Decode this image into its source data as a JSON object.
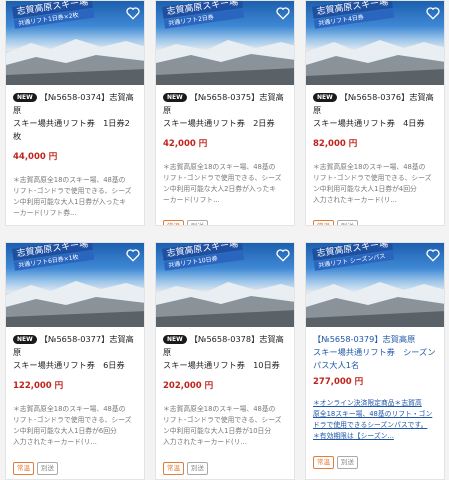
{
  "products": [
    {
      "title": "【№5658-0374】志賀高原スキー場共通リフト券　1日券2枚",
      "title_line1": "【№5658-0374】志賀高原",
      "title_line2": "スキー場共通リフト券　1日券2枚",
      "badge": "NEW",
      "price": "44,000 円",
      "description": "＊志賀高原全18のスキー場、48基のリフト･ゴンドラで使用できる、シーズン中利用可能な大人1日券が入ったキーカード(リフト券...",
      "desc_lines": [
        "＊志賀高原全18のスキー場、48基の",
        "リフト･ゴンドラで使用できる、シーズ",
        "ン中利用可能な大人1日券が入ったキ",
        "ーカード(リフト券..."
      ],
      "banner_main": "志賀高原スキー場",
      "banner_sub": "共通リフト1日券×2枚",
      "tags": [
        "常温",
        "別送"
      ]
    },
    {
      "title": "【№5658-0375】志賀高原スキー場共通リフト券　2日券",
      "title_line1": "【№5658-0375】志賀高原",
      "title_line2": "スキー場共通リフト券　2日券",
      "badge": "NEW",
      "price": "42,000 円",
      "description": "＊志賀高原全18のスキー場、48基のリフト･ゴンドラで使用できる、シーズン中利用可能な大人2日券が入ったキーカード(リフト...",
      "desc_lines": [
        "＊志賀高原全18のスキー場、48基の",
        "リフト･ゴンドラで使用できる、シーズ",
        "ン中利用可能な大人2日券が入ったキ",
        "ーカード(リフト..."
      ],
      "banner_main": "志賀高原スキー場",
      "banner_sub": "共通リフト2日券",
      "tags": [
        "常温",
        "別送"
      ]
    },
    {
      "title": "【№5658-0376】志賀高原スキー場共通リフト券　4日券",
      "title_line1": "【№5658-0376】志賀高原",
      "title_line2": "スキー場共通リフト券　4日券",
      "badge": "NEW",
      "price": "82,000 円",
      "description": "＊志賀高原全18のスキー場、48基のリフト･ゴンドラで使用できる、シーズン中利用可能な大人1日券が4回分入力されたキーカード(リ...",
      "desc_lines": [
        "＊志賀高原全18のスキー場、48基の",
        "リフト･ゴンドラで使用できる、シーズ",
        "ン中利用可能な大人1日券が4回分",
        "入力されたキーカード(リ..."
      ],
      "banner_main": "志賀高原スキー場",
      "banner_sub": "共通リフト4日券",
      "tags": [
        "常温",
        "別送"
      ]
    },
    {
      "title": "【№5658-0377】志賀高原スキー場共通リフト券　6日券",
      "title_line1": "【№5658-0377】志賀高原",
      "title_line2": "スキー場共通リフト券　6日券",
      "badge": "NEW",
      "price": "122,000 円",
      "description": "＊志賀高原全18のスキー場、48基のリフト･ゴンドラで使用できる、シーズン中利用可能な大人1日券が6回分入力されたキーカード(リ...",
      "desc_lines": [
        "＊志賀高原全18のスキー場、48基の",
        "リフト･ゴンドラで使用できる、シーズ",
        "ン中利用可能な大人1日券が6回分",
        "入力されたキーカード(リ..."
      ],
      "banner_main": "志賀高原スキー場",
      "banner_sub": "共通リフト6日券×1枚",
      "tags": [
        "常温",
        "別送"
      ]
    },
    {
      "title": "【№5658-0378】志賀高原スキー場共通リフト券　10日券",
      "title_line1": "【№5658-0378】志賀高原",
      "title_line2": "スキー場共通リフト券　10日券",
      "badge": "NEW",
      "price": "202,000 円",
      "description": "＊志賀高原全18のスキー場、48基のリフト･ゴンドラで使用できる、シーズン中利用可能な大人1日券が10日分入力されたキーカード(リ...",
      "desc_lines": [
        "＊志賀高原全18のスキー場、48基の",
        "リフト･ゴンドラで使用できる、シーズ",
        "ン中利用可能な大人1日券が10日分",
        "入力されたキーカード(リ..."
      ],
      "banner_main": "志賀高原スキー場",
      "banner_sub": "共通リフト10日券",
      "tags": [
        "常温",
        "別送"
      ]
    },
    {
      "title": "【№5658-0379】志賀高原スキー場共通リフト券　シーズンパス大人1名",
      "title_line1": "【№5658-0379】志賀高原",
      "title_line2": "スキー場共通リフト券　シーズン",
      "title_line3": "パス大人1名",
      "badge": "",
      "price": "277,000 円",
      "description": "＊オンライン決済限定商品＊志賀高原全18スキー場、48基のリフト・ゴンドラで使用できるシーズンパスです。＊有効期限は【シーズン...",
      "desc_lines": [
        "＊オンライン決済限定商品＊志賀高",
        "原全18スキー場、48基のリフト・ゴン",
        "ドラで使用できるシーズンパスです。",
        "＊有効期限は【シーズン..."
      ],
      "banner_main": "志賀高原スキー場",
      "banner_sub": "共通リフト シーズンパス",
      "tags": [
        "常温",
        "別送"
      ]
    }
  ],
  "colors": {
    "price": "#c0231c",
    "link_blue": "#1f57a8",
    "tag_normal": "#e37b3a",
    "badge_bg": "#1a1a1a"
  },
  "icons": {
    "favorite": "heart-outline-icon"
  }
}
